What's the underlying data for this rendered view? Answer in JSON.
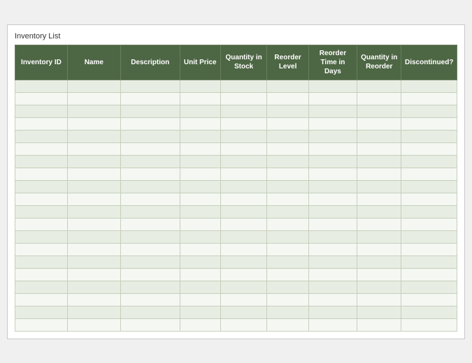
{
  "title": "Inventory List",
  "table": {
    "columns": [
      {
        "id": "inventory-id",
        "label": "Inventory ID",
        "class": "col-inventory-id"
      },
      {
        "id": "name",
        "label": "Name",
        "class": "col-name"
      },
      {
        "id": "description",
        "label": "Description",
        "class": "col-description"
      },
      {
        "id": "unit-price",
        "label": "Unit Price",
        "class": "col-unit-price"
      },
      {
        "id": "qty-stock",
        "label": "Quantity in Stock",
        "class": "col-qty-stock"
      },
      {
        "id": "reorder-level",
        "label": "Reorder Level",
        "class": "col-reorder-level"
      },
      {
        "id": "reorder-time",
        "label": "Reorder Time in Days",
        "class": "col-reorder-time"
      },
      {
        "id": "qty-reorder",
        "label": "Quantity in Reorder",
        "class": "col-qty-reorder"
      },
      {
        "id": "discontinued",
        "label": "Discontinued?",
        "class": "col-discontinued"
      }
    ],
    "row_count": 20
  }
}
